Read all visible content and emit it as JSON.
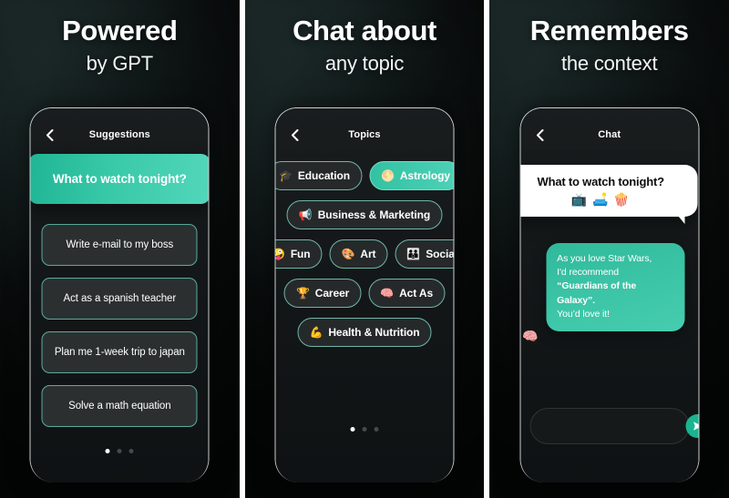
{
  "panels": [
    {
      "headline_line1": "Powered",
      "headline_line2": "by GPT",
      "screen_title": "Suggestions",
      "back_icon": "chevron-left-icon",
      "primary_suggestion": "What to watch tonight?",
      "suggestions": [
        "Write e-mail to my boss",
        "Act as a spanish teacher",
        "Plan me 1-week trip to japan",
        "Solve a math equation"
      ],
      "page_dots": {
        "count": 3,
        "active": 0
      }
    },
    {
      "headline_line1": "Chat about",
      "headline_line2": "any topic",
      "screen_title": "Topics",
      "back_icon": "chevron-left-icon",
      "topics": [
        {
          "label": "Education",
          "emoji": "🎓",
          "emoji_name": "graduation-cap-emoji",
          "active": false
        },
        {
          "label": "Astrology",
          "emoji": "🌕",
          "emoji_name": "moon-emoji",
          "active": true
        },
        {
          "label": "Business & Marketing",
          "emoji": "📢",
          "emoji_name": "megaphone-emoji",
          "active": false
        },
        {
          "label": "Fun",
          "emoji": "🤪",
          "emoji_name": "zany-face-emoji",
          "active": false
        },
        {
          "label": "Art",
          "emoji": "🎨",
          "emoji_name": "palette-emoji",
          "active": false
        },
        {
          "label": "Social",
          "emoji": "👪",
          "emoji_name": "family-emoji",
          "active": false
        },
        {
          "label": "Career",
          "emoji": "🏆",
          "emoji_name": "trophy-emoji",
          "active": false
        },
        {
          "label": "Act As",
          "emoji": "🧠",
          "emoji_name": "brain-emoji",
          "active": false
        },
        {
          "label": "Health & Nutrition",
          "emoji": "💪",
          "emoji_name": "flexed-biceps-emoji",
          "active": false
        }
      ],
      "page_dots": {
        "count": 3,
        "active": 0
      }
    },
    {
      "headline_line1": "Remembers",
      "headline_line2": "the context",
      "screen_title": "Chat",
      "back_icon": "chevron-left-icon",
      "user_message": "What to watch tonight?",
      "user_message_emojis": "📺 🛋️ 🍿",
      "bot_message": {
        "line1": "As you love Star Wars,",
        "line2": "I'd recommend",
        "highlight": "“Guardians of the Galaxy”.",
        "line4": "You’d love it!"
      },
      "bot_avatar_emoji": "🧠",
      "composer_placeholder": "",
      "composer_value": "",
      "send_icon": "send-paper-plane-icon"
    }
  ],
  "colors": {
    "accent_teal": "#33c1a2",
    "accent_teal_light": "#53d6bb",
    "chip_border": "#6fb6a7",
    "panel_bg": "#0d1312",
    "bubble_white": "#ffffff"
  }
}
